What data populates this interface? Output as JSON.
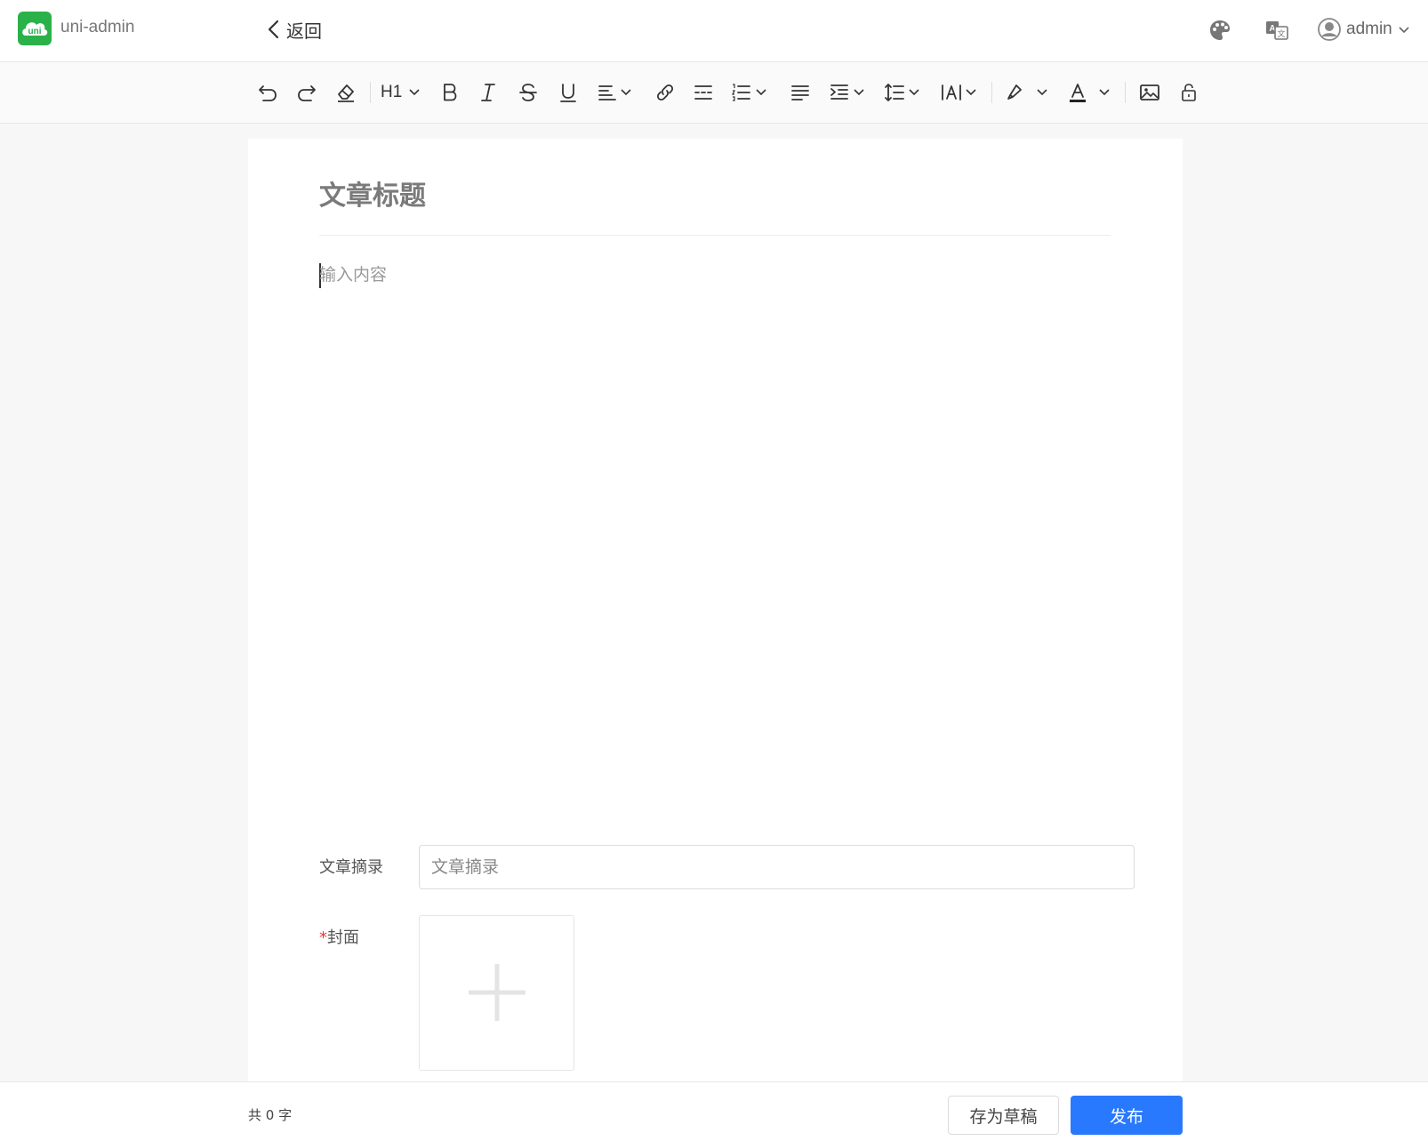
{
  "header": {
    "logo_text": "uni",
    "app_name": "uni-admin",
    "back_label": "返回",
    "theme_icon": "palette-icon",
    "lang_icon": "translate-icon",
    "user_name": "admin"
  },
  "toolbar": {
    "heading_label": "H1",
    "items": [
      "undo",
      "redo",
      "clear-format",
      "heading",
      "bold",
      "italic",
      "strikethrough",
      "underline",
      "align",
      "link",
      "divider",
      "list",
      "justify",
      "indent",
      "line-height",
      "letter-spacing",
      "highlight",
      "font-color",
      "image",
      "lock"
    ]
  },
  "editor": {
    "title_placeholder": "文章标题",
    "content_placeholder": "输入内容",
    "summary_label": "文章摘录",
    "summary_placeholder": "文章摘录",
    "cover_required_mark": "*",
    "cover_label": "封面"
  },
  "footer": {
    "word_count": "共 0 字",
    "draft_label": "存为草稿",
    "publish_label": "发布"
  },
  "colors": {
    "brand_green": "#2bb14a",
    "primary_blue": "#2979ff",
    "required_red": "#ee3333"
  }
}
